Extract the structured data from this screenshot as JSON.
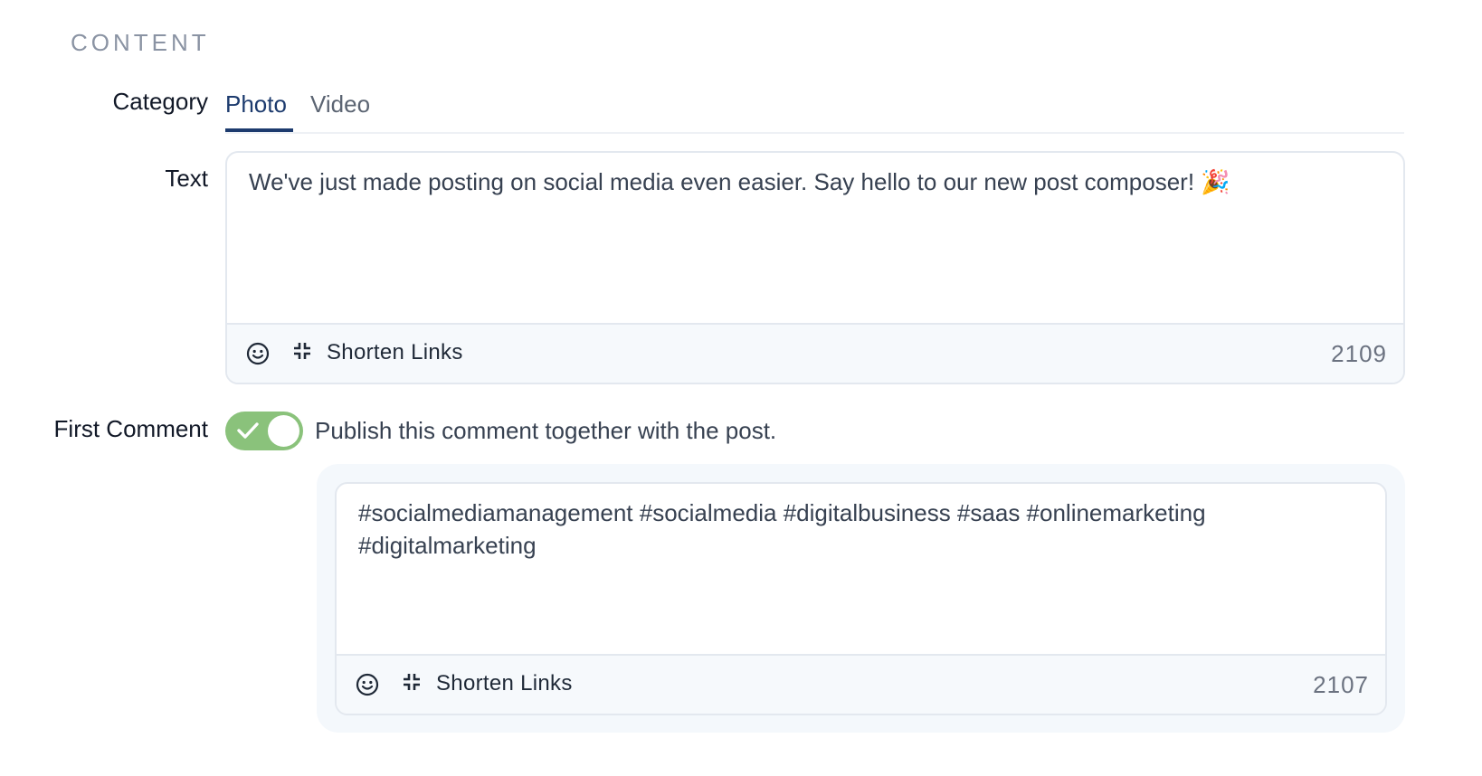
{
  "section": {
    "title": "CONTENT"
  },
  "category": {
    "label": "Category",
    "tabs": [
      {
        "label": "Photo",
        "selected": true
      },
      {
        "label": "Video",
        "selected": false
      }
    ]
  },
  "text": {
    "label": "Text",
    "value": "We've just made posting on social media even easier. Say hello to our new post composer! 🎉",
    "toolbar": {
      "emoji_icon": "smiley-icon",
      "shorten_icon": "compress-icon",
      "shorten_label": "Shorten Links",
      "char_count": "2109"
    }
  },
  "first_comment": {
    "label": "First Comment",
    "toggle_on": true,
    "toggle_color": "#8ac27b",
    "description": "Publish this comment together with the post.",
    "value": "#socialmediamanagement #socialmedia #digitalbusiness #saas #onlinemarketing #digitalmarketing",
    "toolbar": {
      "emoji_icon": "smiley-icon",
      "shorten_icon": "compress-icon",
      "shorten_label": "Shorten Links",
      "char_count": "2107"
    }
  },
  "colors": {
    "accent": "#1d3b6e",
    "muted": "#8a93a3",
    "toolbar_bg": "#f6f9fc",
    "panel_bg": "#f4f8fc"
  }
}
